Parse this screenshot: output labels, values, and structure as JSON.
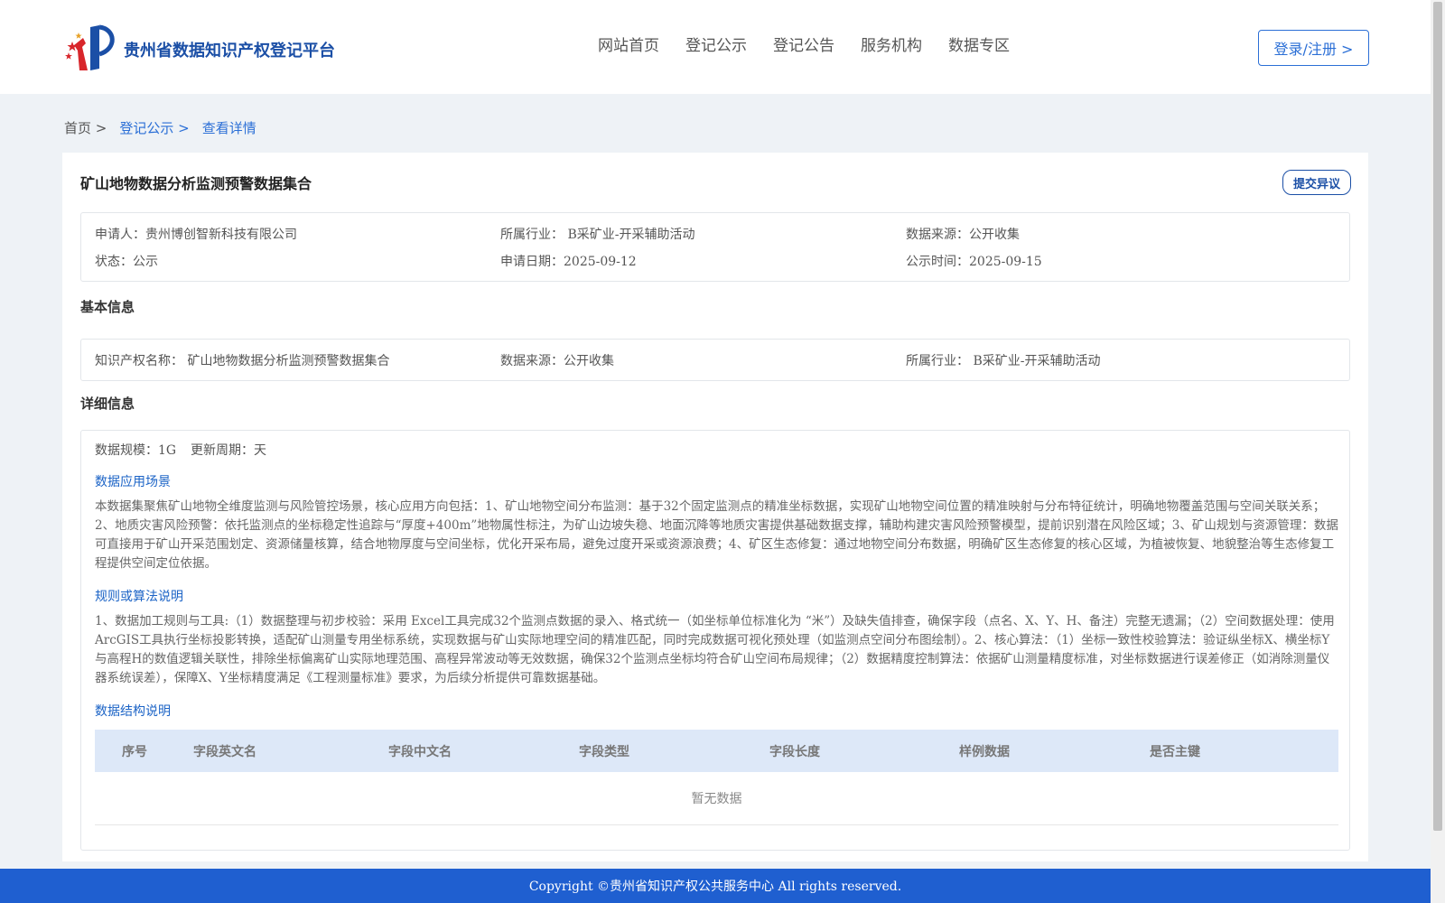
{
  "header": {
    "site_title": "贵州省数据知识产权登记平台",
    "nav": [
      "网站首页",
      "登记公示",
      "登记公告",
      "服务机构",
      "数据专区"
    ],
    "login_label": "登录/注册 >"
  },
  "breadcrumb": {
    "home": "首页 >",
    "section": "登记公示 >",
    "current": "查看详情"
  },
  "record": {
    "title": "矿山地物数据分析监测预警数据集合",
    "objection_label": "提交异议",
    "summary": {
      "applicant": "申请人：贵州博创智新科技有限公司",
      "industry": "所属行业： B采矿业-开采辅助活动",
      "source": "数据来源：公开收集",
      "status": "状态：公示",
      "apply_date": "申请日期：2025-09-12",
      "publish_time": "公示时间：2025-09-15"
    }
  },
  "basic": {
    "title": "基本信息",
    "ip_name": "知识产权名称： 矿山地物数据分析监测预警数据集合",
    "source": "数据来源：公开收集",
    "industry": "所属行业： B采矿业-开采辅助活动"
  },
  "detail": {
    "title": "详细信息",
    "scale": "数据规模：1G",
    "cycle": "更新周期：天",
    "scenario_title": "数据应用场景",
    "scenario_text": "本数据集聚焦矿山地物全维度监测与风险管控场景，核心应用方向包括：1、矿山地物空间分布监测：基于32个固定监测点的精准坐标数据，实现矿山地物空间位置的精准映射与分布特征统计，明确地物覆盖范围与空间关联关系；2、地质灾害风险预警：依托监测点的坐标稳定性追踪与“厚度+400m”地物属性标注，为矿山边坡失稳、地面沉降等地质灾害提供基础数据支撑，辅助构建灾害风险预警模型，提前识别潜在风险区域；3、矿山规划与资源管理：数据可直接用于矿山开采范围划定、资源储量核算，结合地物厚度与空间坐标，优化开采布局，避免过度开采或资源浪费；4、矿区生态修复：通过地物空间分布数据，明确矿区生态修复的核心区域，为植被恢复、地貌整治等生态修复工程提供空间定位依据。",
    "rules_title": "规则或算法说明",
    "rules_text": "1、数据加工规则与工具:（1）数据整理与初步校验：采用 Excel工具完成32个监测点数据的录入、格式统一（如坐标单位标准化为 “米”）及缺失值排查，确保字段（点名、X、Y、H、备注）完整无遗漏；（2）空间数据处理：使用ArcGIS工具执行坐标投影转换，适配矿山测量专用坐标系统，实现数据与矿山实际地理空间的精准匹配，同时完成数据可视化预处理（如监测点空间分布图绘制）。2、核心算法：（1）坐标一致性校验算法：验证纵坐标X、横坐标Y与高程H的数值逻辑关联性，排除坐标偏离矿山实际地理范围、高程异常波动等无效数据，确保32个监测点坐标均符合矿山空间布局规律；（2）数据精度控制算法：依据矿山测量精度标准，对坐标数据进行误差修正（如消除测量仪器系统误差），保障X、Y坐标精度满足《工程测量标准》要求，为后续分析提供可靠数据基础。",
    "structure_title": "数据结构说明",
    "table_headers": [
      "序号",
      "字段英文名",
      "字段中文名",
      "字段类型",
      "字段长度",
      "样例数据",
      "是否主键"
    ],
    "empty_text": "暂无数据"
  },
  "footer": {
    "copyright": "Copyright ©贵州省知识产权公共服务中心 All rights reserved."
  }
}
